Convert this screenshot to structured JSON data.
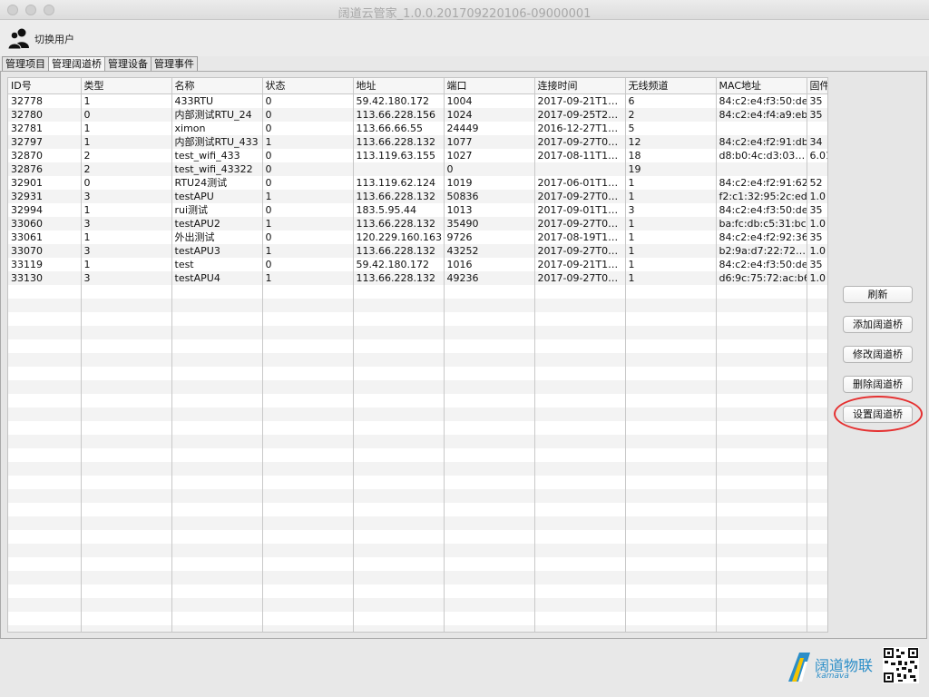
{
  "window": {
    "title": "阔道云管家_1.0.0.201709220106-09000001"
  },
  "user_bar": {
    "switch_user_label": "切换用户",
    "icon": "users-icon"
  },
  "tabs": [
    {
      "label": "管理项目",
      "active": false
    },
    {
      "label": "管理阔道桥",
      "active": true
    },
    {
      "label": "管理设备",
      "active": false
    },
    {
      "label": "管理事件",
      "active": false
    }
  ],
  "table": {
    "columns": [
      "ID号",
      "类型",
      "名称",
      "状态",
      "地址",
      "端口",
      "连接时间",
      "无线频道",
      "MAC地址",
      "固件"
    ],
    "rows": [
      [
        "32778",
        "1",
        "433RTU",
        "0",
        "59.42.180.172",
        "1004",
        "2017-09-21T1…",
        "6",
        "84:c2:e4:f3:50:de",
        "35"
      ],
      [
        "32780",
        "0",
        "内部测试RTU_24",
        "0",
        "113.66.228.156",
        "1024",
        "2017-09-25T2…",
        "2",
        "84:c2:e4:f4:a9:eb",
        "35"
      ],
      [
        "32781",
        "1",
        "ximon",
        "0",
        "113.66.66.55",
        "24449",
        "2016-12-27T1…",
        "5",
        "",
        ""
      ],
      [
        "32797",
        "1",
        "内部测试RTU_433",
        "1",
        "113.66.228.132",
        "1077",
        "2017-09-27T0…",
        "12",
        "84:c2:e4:f2:91:db",
        "34"
      ],
      [
        "32870",
        "2",
        "test_wifi_433",
        "0",
        "113.119.63.155",
        "1027",
        "2017-08-11T1…",
        "18",
        "d8:b0:4c:d3:03…",
        "6.01"
      ],
      [
        "32876",
        "2",
        "test_wifi_43322",
        "0",
        "",
        "0",
        "",
        "19",
        "",
        ""
      ],
      [
        "32901",
        "0",
        "RTU24测试",
        "0",
        "113.119.62.124",
        "1019",
        "2017-06-01T1…",
        "1",
        "84:c2:e4:f2:91:62",
        "52"
      ],
      [
        "32931",
        "3",
        "testAPU",
        "1",
        "113.66.228.132",
        "50836",
        "2017-09-27T0…",
        "1",
        "f2:c1:32:95:2c:ed",
        "1.0"
      ],
      [
        "32994",
        "1",
        "rui测试",
        "0",
        "183.5.95.44",
        "1013",
        "2017-09-01T1…",
        "3",
        "84:c2:e4:f3:50:de",
        "35"
      ],
      [
        "33060",
        "3",
        "testAPU2",
        "1",
        "113.66.228.132",
        "35490",
        "2017-09-27T0…",
        "1",
        "ba:fc:db:c5:31:bc",
        "1.0"
      ],
      [
        "33061",
        "1",
        "外出测试",
        "0",
        "120.229.160.163",
        "9726",
        "2017-08-19T1…",
        "1",
        "84:c2:e4:f2:92:36",
        "35"
      ],
      [
        "33070",
        "3",
        "testAPU3",
        "1",
        "113.66.228.132",
        "43252",
        "2017-09-27T0…",
        "1",
        "b2:9a:d7:22:72…",
        "1.0"
      ],
      [
        "33119",
        "1",
        "test",
        "0",
        "59.42.180.172",
        "1016",
        "2017-09-21T1…",
        "1",
        "84:c2:e4:f3:50:de",
        "35"
      ],
      [
        "33130",
        "3",
        "testAPU4",
        "1",
        "113.66.228.132",
        "49236",
        "2017-09-27T0…",
        "1",
        "d6:9c:75:72:ac:b6",
        "1.0"
      ]
    ]
  },
  "side_buttons": {
    "refresh": "刷新",
    "add": "添加阔道桥",
    "edit": "修改阔道桥",
    "delete": "删除阔道桥",
    "configure": "设置阔道桥"
  },
  "highlight": {
    "target": "configure",
    "color": "#e53030"
  },
  "brand": {
    "name_cn": "阔道物联",
    "name_en": "kamava",
    "color": "#2b8ec8"
  }
}
